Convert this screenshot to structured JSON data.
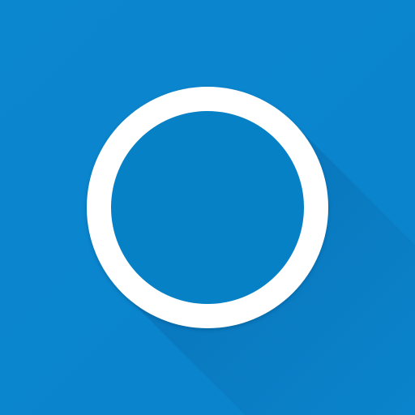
{
  "icon": {
    "name": "circle-ring-icon",
    "colors": {
      "background": "#0A84CC",
      "background_light": "#0B87CF",
      "ring": "#FFFFFF",
      "inner": "#0781C6",
      "long_shadow": "#075FA0"
    }
  }
}
